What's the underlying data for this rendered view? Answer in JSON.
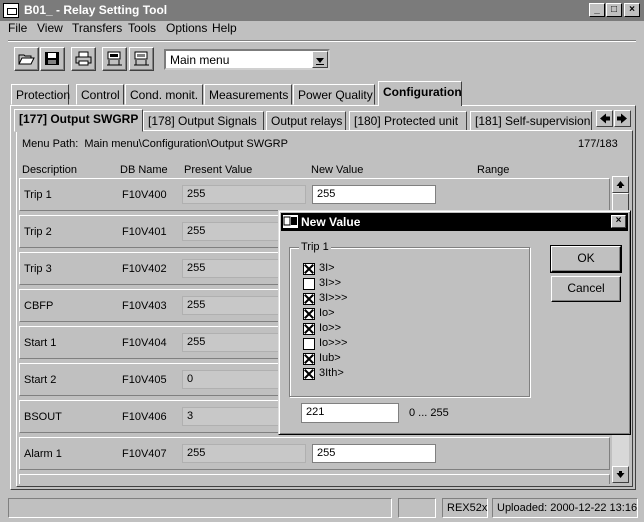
{
  "window": {
    "title": "B01_ - Relay Setting Tool"
  },
  "menu": [
    "File",
    "View",
    "Transfers",
    "Tools",
    "Options",
    "Help"
  ],
  "toolbar": {
    "combo_value": "Main menu"
  },
  "main_tabs": [
    "Protection",
    "Control",
    "Cond. monit.",
    "Measurements",
    "Power Quality",
    "Configuration"
  ],
  "sub_tabs": [
    "[177] Output SWGRP",
    "[178] Output Signals",
    "Output relays",
    "[180] Protected unit",
    "[181] Self-supervision"
  ],
  "menu_path": "Menu Path:  Main menu\\Configuration\\Output SWGRP",
  "page_count": "177/183",
  "columns": {
    "description": "Description",
    "db_name": "DB Name",
    "present_value": "Present Value",
    "new_value": "New Value",
    "range": "Range"
  },
  "rows": [
    {
      "desc": "Trip 1",
      "db": "F10V400",
      "pv": "255",
      "nv": "255"
    },
    {
      "desc": "Trip 2",
      "db": "F10V401",
      "pv": "255",
      "nv": ""
    },
    {
      "desc": "Trip 3",
      "db": "F10V402",
      "pv": "255",
      "nv": ""
    },
    {
      "desc": "CBFP",
      "db": "F10V403",
      "pv": "255",
      "nv": ""
    },
    {
      "desc": "Start 1",
      "db": "F10V404",
      "pv": "255",
      "nv": ""
    },
    {
      "desc": "Start 2",
      "db": "F10V405",
      "pv": "0",
      "nv": ""
    },
    {
      "desc": "BSOUT",
      "db": "F10V406",
      "pv": "3",
      "nv": ""
    },
    {
      "desc": "Alarm 1",
      "db": "F10V407",
      "pv": "255",
      "nv": "255"
    }
  ],
  "status": {
    "device": "REX52x",
    "uploaded": "Uploaded: 2000-12-22 13:16"
  },
  "dialog": {
    "title": "New Value",
    "group": "Trip 1",
    "options": [
      {
        "label": "3I>",
        "checked": true
      },
      {
        "label": "3I>>",
        "checked": false
      },
      {
        "label": "3I>>>",
        "checked": true
      },
      {
        "label": "Io>",
        "checked": true
      },
      {
        "label": "Io>>",
        "checked": true
      },
      {
        "label": "Io>>>",
        "checked": false
      },
      {
        "label": "Iub>",
        "checked": true
      },
      {
        "label": "3Ith>",
        "checked": true
      }
    ],
    "ok": "OK",
    "cancel": "Cancel",
    "value": "221",
    "range": "0 ... 255"
  }
}
